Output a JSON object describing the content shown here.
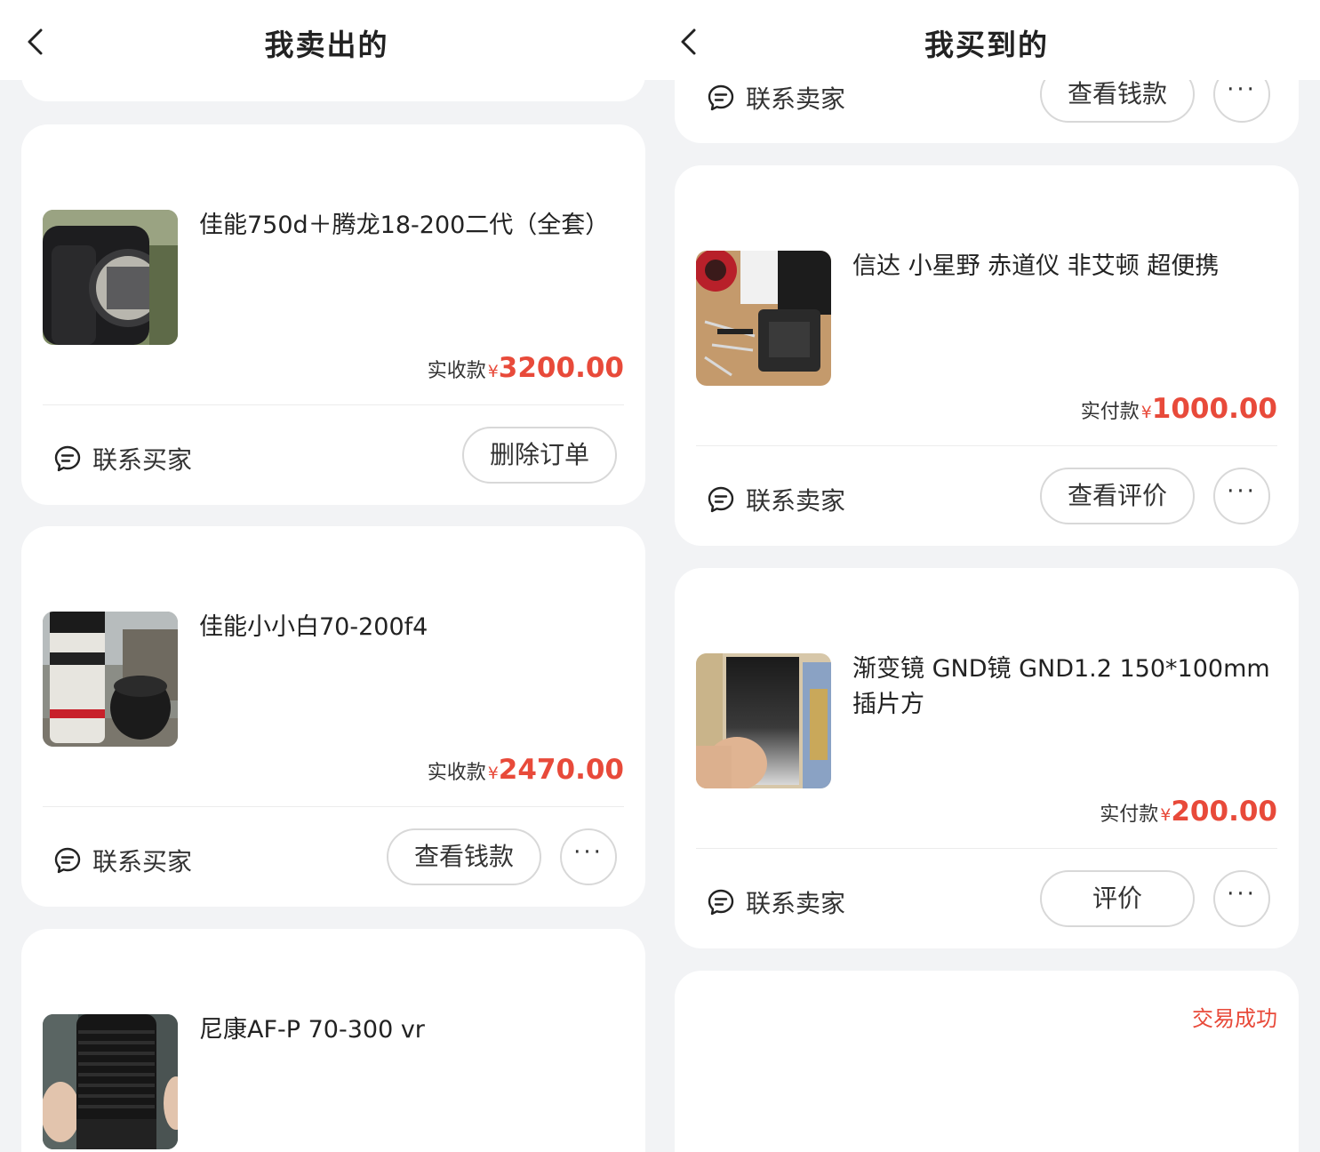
{
  "left": {
    "title": "我卖出的",
    "orders": [
      {
        "title": "佳能750d＋腾龙18-200二代（全套）",
        "price_label": "实收款",
        "currency": "¥",
        "price": "3200.00",
        "contact_label": "联系买家",
        "action_label": "删除订单"
      },
      {
        "title": "佳能小小白70-200f4",
        "price_label": "实收款",
        "currency": "¥",
        "price": "2470.00",
        "contact_label": "联系买家",
        "action_label": "查看钱款",
        "more_label": "···"
      },
      {
        "title": "尼康AF-P 70-300 vr"
      }
    ]
  },
  "right": {
    "title": "我买到的",
    "top_partial": {
      "contact_label": "联系卖家",
      "action_label": "查看钱款",
      "more_label": "···"
    },
    "orders": [
      {
        "title": "信达 小星野 赤道仪 非艾顿 超便携",
        "price_label": "实付款",
        "currency": "¥",
        "price": "1000.00",
        "contact_label": "联系卖家",
        "action_label": "查看评价",
        "more_label": "···"
      },
      {
        "title": "渐变镜 GND镜 GND1.2 150*100mm 插片方",
        "price_label": "实付款",
        "currency": "¥",
        "price": "200.00",
        "contact_label": "联系卖家",
        "action_label": "评价",
        "more_label": "···"
      }
    ],
    "bottom_partial": {
      "status": "交易成功"
    }
  },
  "colors": {
    "accent": "#e84a3a",
    "background": "#f2f3f5",
    "card": "#ffffff"
  }
}
